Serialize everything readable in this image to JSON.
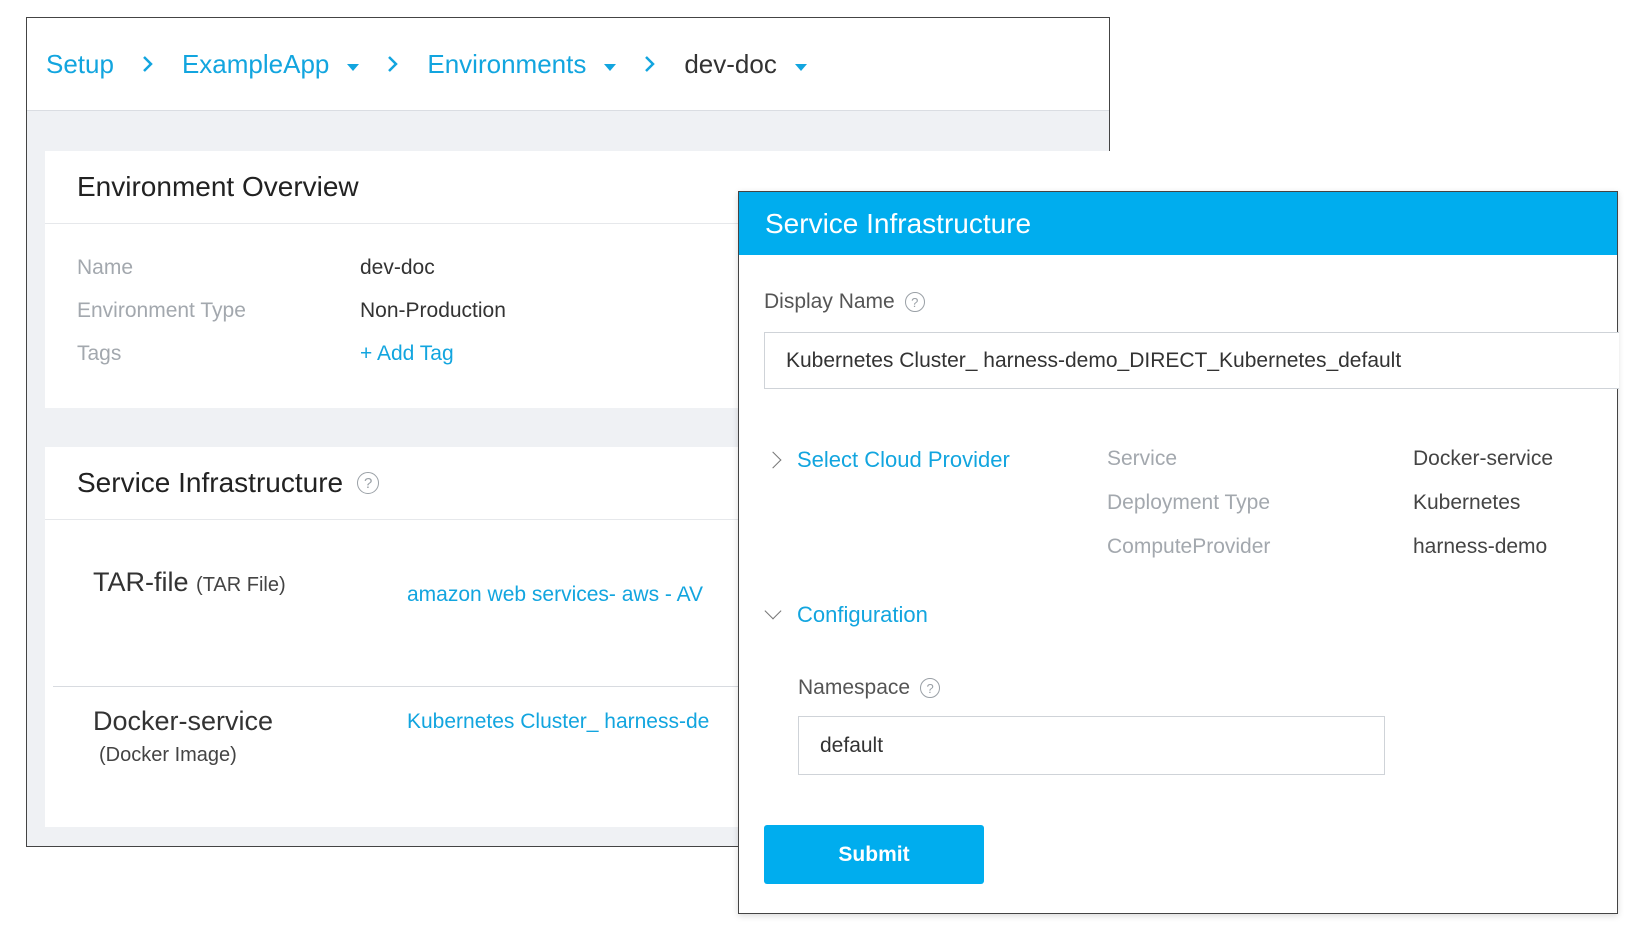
{
  "breadcrumb": {
    "items": [
      {
        "label": "Setup"
      },
      {
        "label": "ExampleApp"
      },
      {
        "label": "Environments"
      },
      {
        "label": "dev-doc"
      }
    ]
  },
  "overview": {
    "title": "Environment Overview",
    "fields": [
      {
        "label": "Name",
        "value": "dev-doc"
      },
      {
        "label": "Environment Type",
        "value": "Non-Production"
      },
      {
        "label": "Tags",
        "value": "+ Add Tag"
      }
    ]
  },
  "infrastructure": {
    "title": "Service Infrastructure",
    "rows": [
      {
        "name": "TAR-file",
        "type": "(TAR File)",
        "link": "amazon web services- aws - AV"
      },
      {
        "name": "Docker-service",
        "type": "(Docker Image)",
        "link": "Kubernetes Cluster_ harness-de"
      }
    ]
  },
  "modal": {
    "title": "Service Infrastructure",
    "display_name_label": "Display Name",
    "display_name_value": "Kubernetes Cluster_ harness-demo_DIRECT_Kubernetes_default",
    "select_cloud_provider": "Select Cloud Provider",
    "info": [
      {
        "label": "Service",
        "value": "Docker-service"
      },
      {
        "label": "Deployment Type",
        "value": "Kubernetes"
      },
      {
        "label": "ComputeProvider",
        "value": "harness-demo"
      }
    ],
    "configuration": "Configuration",
    "namespace_label": "Namespace",
    "namespace_value": "default",
    "submit_label": "Submit"
  },
  "colors": {
    "accent": "#00adee",
    "link": "#12a5df",
    "muted_label": "#a3a8ae"
  },
  "icons": {
    "help": "question-circle-icon",
    "chevron_right": "chevron-right-icon",
    "chevron_down": "chevron-down-icon",
    "caret_down": "caret-down-icon"
  }
}
